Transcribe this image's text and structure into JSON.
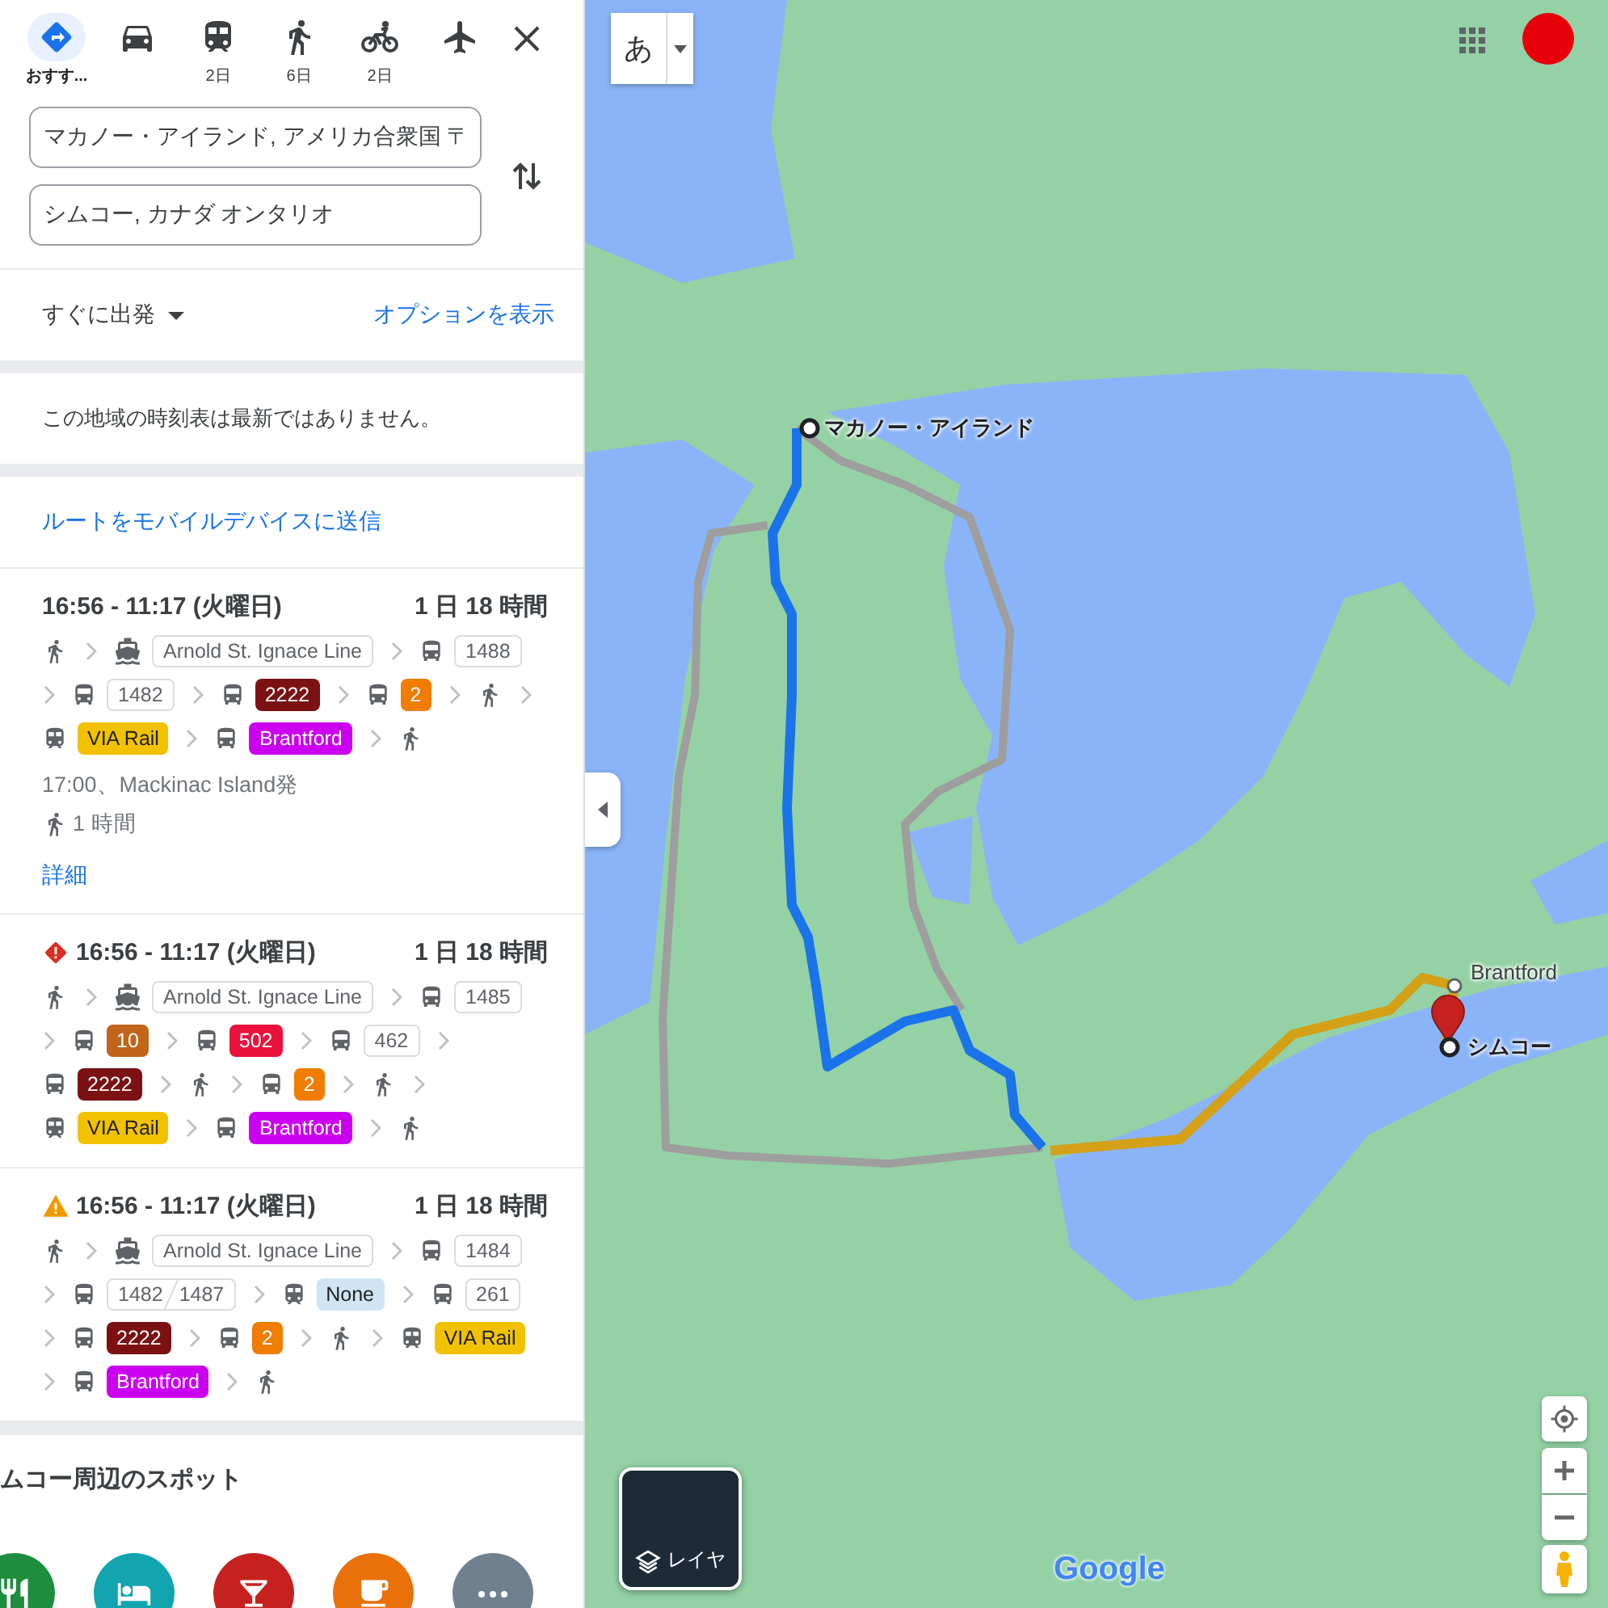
{
  "modes": [
    {
      "kind": "best",
      "label": "おすす...",
      "selected": true
    },
    {
      "kind": "car",
      "selected": false
    },
    {
      "kind": "transit",
      "label": "2日",
      "selected": false
    },
    {
      "kind": "walk",
      "label": "6日",
      "selected": false
    },
    {
      "kind": "bike",
      "label": "2日",
      "selected": false
    },
    {
      "kind": "flight",
      "selected": false
    }
  ],
  "origin": {
    "value": "マカノー・アイランド, アメリカ合衆国 〒"
  },
  "destination": {
    "value": "シムコー, カナダ オンタリオ"
  },
  "departure": {
    "label": "すぐに出発"
  },
  "options_link": "オプションを表示",
  "notice": "この地域の時刻表は最新ではありません。",
  "send_link": "ルートをモバイルデバイスに送信",
  "routes": [
    {
      "kind": "normal",
      "times": "16:56 - 11:17 (火曜日)",
      "duration": "1 日 18 時間",
      "steps": [
        {
          "kind": "walk"
        },
        {
          "kind": "ferry",
          "label": "Arnold St. Ignace Line"
        },
        {
          "kind": "bus",
          "label": "1488"
        },
        {
          "kind": "bus",
          "label": "1482"
        },
        {
          "kind": "bus",
          "label": "2222",
          "color": "#7b1113"
        },
        {
          "kind": "bus",
          "label": "2",
          "color": "#f07c00"
        },
        {
          "kind": "walk"
        },
        {
          "kind": "train",
          "label": "VIA Rail",
          "color": "#f2c200"
        },
        {
          "kind": "bus",
          "label": "Brantford",
          "color": "#cc00f0"
        },
        {
          "kind": "walk"
        }
      ],
      "departure_info": "17:00、Mackinac Island発",
      "walk_time": "1 時間",
      "details_link": "詳細"
    },
    {
      "kind": "error",
      "times": "16:56 - 11:17 (火曜日)",
      "duration": "1 日 18 時間",
      "steps": [
        {
          "kind": "walk"
        },
        {
          "kind": "ferry",
          "label": "Arnold St. Ignace Line"
        },
        {
          "kind": "bus",
          "label": "1485"
        },
        {
          "kind": "bus",
          "label": "10",
          "color": "#c0651a"
        },
        {
          "kind": "bus",
          "label": "502",
          "color": "#e8123c"
        },
        {
          "kind": "bus",
          "label": "462"
        },
        {
          "kind": "bus",
          "label": "2222",
          "color": "#7b1113"
        },
        {
          "kind": "walk"
        },
        {
          "kind": "bus",
          "label": "2",
          "color": "#f07c00"
        },
        {
          "kind": "walk"
        },
        {
          "kind": "train",
          "label": "VIA Rail",
          "color": "#f2c200"
        },
        {
          "kind": "bus",
          "label": "Brantford",
          "color": "#cc00f0"
        },
        {
          "kind": "walk"
        }
      ]
    },
    {
      "kind": "warning",
      "times": "16:56 - 11:17 (火曜日)",
      "duration": "1 日 18 時間",
      "steps": [
        {
          "kind": "walk"
        },
        {
          "kind": "ferry",
          "label": "Arnold St. Ignace Line"
        },
        {
          "kind": "bus",
          "label": "1484"
        },
        {
          "kind": "bus",
          "labels": [
            "1482",
            "1487"
          ]
        },
        {
          "kind": "train",
          "label": "None",
          "color": "#cfe5f3"
        },
        {
          "kind": "bus",
          "label": "261"
        },
        {
          "kind": "bus",
          "label": "2222",
          "color": "#7b1113"
        },
        {
          "kind": "bus",
          "label": "2",
          "color": "#f07c00"
        },
        {
          "kind": "walk"
        },
        {
          "kind": "train",
          "label": "VIA Rail",
          "color": "#f2c200"
        },
        {
          "kind": "bus",
          "label": "Brantford",
          "color": "#cc00f0"
        },
        {
          "kind": "walk"
        }
      ]
    }
  ],
  "nearby": {
    "title": "ムコー周辺のスポット",
    "categories": [
      {
        "kind": "restaurant",
        "color": "#1e8e3e"
      },
      {
        "kind": "hotel",
        "color": "#12a4af"
      },
      {
        "kind": "bar",
        "color": "#c5221f"
      },
      {
        "kind": "cafe",
        "color": "#e8710a"
      },
      {
        "kind": "more",
        "color": "#70808e"
      }
    ]
  },
  "map": {
    "input_tool": "あ",
    "origin_label": "マカノー・アイランド",
    "transfer_label": "Brantford",
    "destination_label": "シムコー",
    "layers_label": "レイヤ",
    "logo": "Google"
  }
}
